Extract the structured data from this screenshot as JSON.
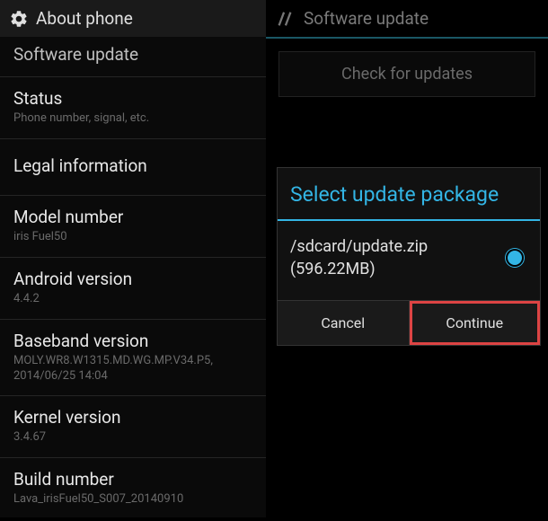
{
  "left": {
    "header": "About phone",
    "items": [
      {
        "title": "Software update",
        "sub": ""
      },
      {
        "title": "Status",
        "sub": "Phone number, signal, etc."
      },
      {
        "title": "Legal information",
        "sub": ""
      },
      {
        "title": "Model number",
        "sub": "iris Fuel50"
      },
      {
        "title": "Android version",
        "sub": "4.4.2"
      },
      {
        "title": "Baseband version",
        "sub": "MOLY.WR8.W1315.MD.WG.MP.V34.P5, 2014/06/25 14:04"
      },
      {
        "title": "Kernel version",
        "sub": "3.4.67"
      },
      {
        "title": "Build number",
        "sub": "Lava_irisFuel50_S007_20140910"
      }
    ]
  },
  "right": {
    "header": "Software update",
    "check_button": "Check for updates",
    "dialog": {
      "title": "Select update package",
      "file_path": "/sdcard/update.zip",
      "file_size": "(596.22MB)",
      "cancel": "Cancel",
      "continue": "Continue"
    }
  }
}
